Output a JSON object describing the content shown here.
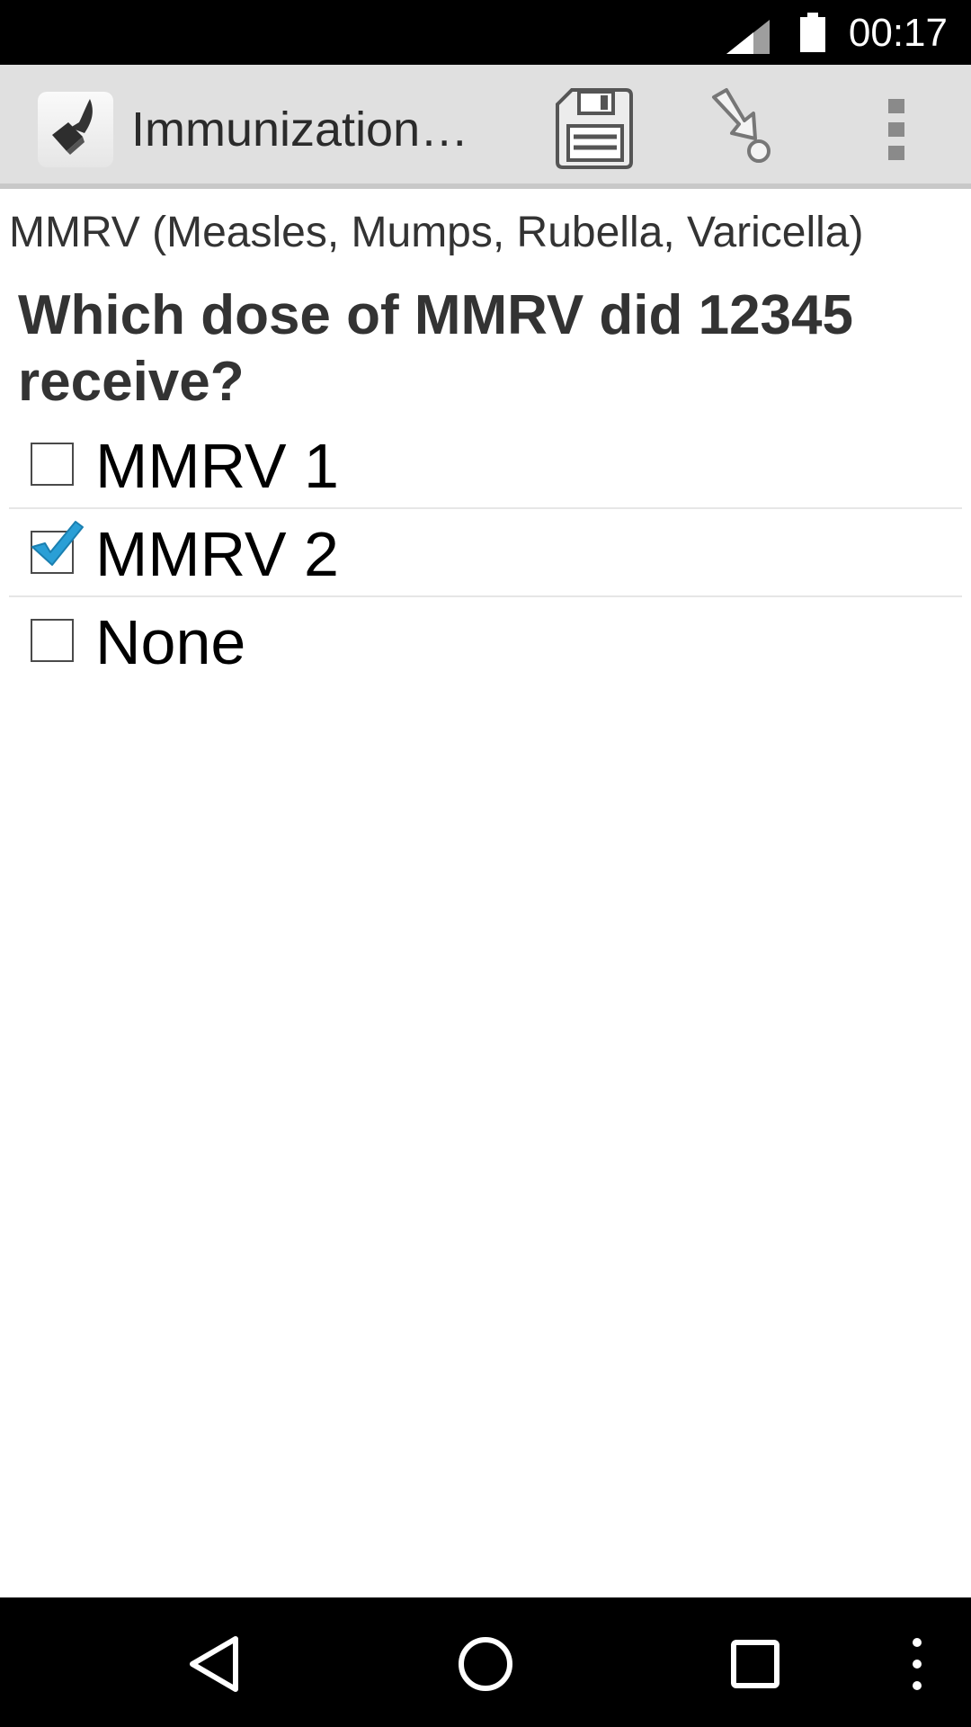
{
  "status_bar": {
    "time": "00:17",
    "signal_icon": "cell-signal-icon",
    "battery_icon": "battery-icon"
  },
  "action_bar": {
    "app_icon": "app-logo-icon",
    "title": "Immunization…",
    "save_icon": "save-icon",
    "goto_icon": "go-to-prompt-icon",
    "overflow_icon": "overflow-menu-icon",
    "background": "#e0e0e0"
  },
  "form": {
    "group_label": "MMRV (Measles, Mumps, Rubella, Varicella)",
    "question": "Which dose of MMRV did 12345 receive?",
    "choices": [
      {
        "label": "MMRV 1",
        "checked": false
      },
      {
        "label": "MMRV 2",
        "checked": true
      },
      {
        "label": "None",
        "checked": false
      }
    ],
    "check_color": "#2a9fd6"
  },
  "nav_bar": {
    "back_icon": "back-icon",
    "home_icon": "home-icon",
    "recents_icon": "recent-apps-icon",
    "menu_icon": "menu-icon"
  }
}
